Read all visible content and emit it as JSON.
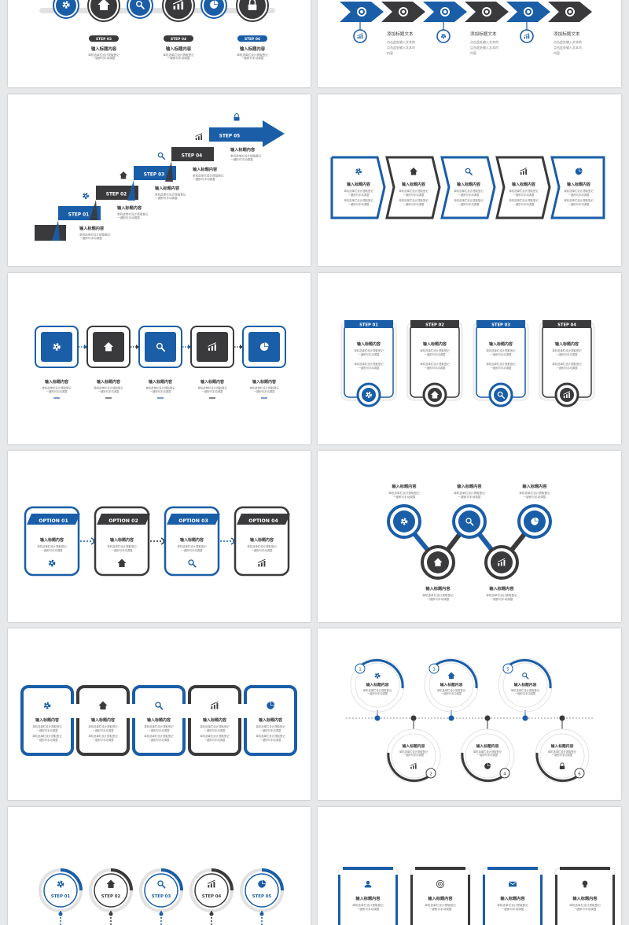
{
  "colors": {
    "blue": "#1a5ea8",
    "dark": "#3a3a3c",
    "light": "#e2e2e2",
    "text": "#333333",
    "sub": "#777777"
  },
  "icons": [
    "gear-icon",
    "home-icon",
    "search-icon",
    "chart-icon",
    "pie-icon",
    "lock-icon",
    "user-icon",
    "target-icon",
    "mail-icon",
    "bulb-icon"
  ],
  "text": {
    "title": "输入标题内容",
    "desc1": "单机选单栏设计提取登记",
    "desc2": "一键即可手动调整",
    "add_title": "添加标题文本",
    "add_desc1": "点击此处输入文本的",
    "add_desc2": "点击此处输入文本内",
    "add_desc3": "内容"
  },
  "s1_steps": [
    "STEP 02",
    "STEP 04",
    "STEP 06"
  ],
  "s3_steps": [
    "STEP 01",
    "STEP 02",
    "STEP 03",
    "STEP 04",
    "STEP 05"
  ],
  "s6_steps": [
    "STEP 01",
    "STEP 02",
    "STEP 03",
    "STEP 04"
  ],
  "s7_options": [
    "OPTION  01",
    "OPTION  02",
    "OPTION  03",
    "OPTION  04"
  ],
  "s10_numbers": [
    "1",
    "2",
    "3",
    "4",
    "5",
    "6"
  ],
  "s11_steps": [
    "STEP 01",
    "STEP 02",
    "STEP 03",
    "STEP 04",
    "STEP 05"
  ]
}
